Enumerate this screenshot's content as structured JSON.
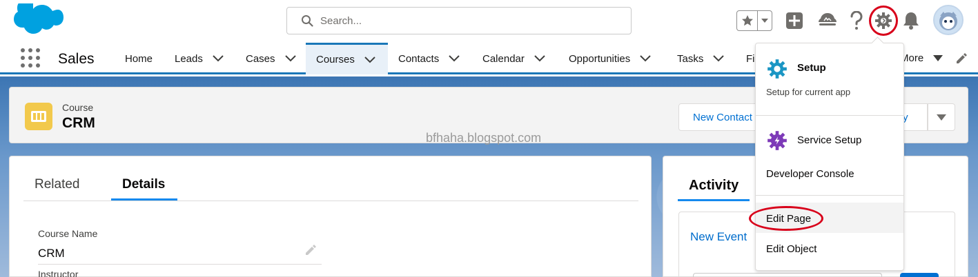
{
  "header": {
    "search_placeholder": "Search...",
    "icons": [
      "salesforce-logo",
      "search-icon",
      "star-icon",
      "chevron-down-icon",
      "plus-icon",
      "trailhead-icon",
      "help-icon",
      "gear-icon",
      "bell-icon",
      "avatar"
    ]
  },
  "nav": {
    "app_name": "Sales",
    "items": [
      {
        "label": "Home"
      },
      {
        "label": "Leads"
      },
      {
        "label": "Cases"
      },
      {
        "label": "Courses"
      },
      {
        "label": "Contacts"
      },
      {
        "label": "Calendar"
      },
      {
        "label": "Opportunities"
      },
      {
        "label": "Tasks"
      },
      {
        "label": "Fi"
      }
    ],
    "more_label": "More",
    "active_tab": "Courses"
  },
  "record": {
    "type_label": "Course",
    "name": "CRM",
    "button_new_contact": "New Contact",
    "button_partial": "ty"
  },
  "watermark": "bfhaha.blogspot.com",
  "details": {
    "tab_related": "Related",
    "tab_details": "Details",
    "field1_label": "Course Name",
    "field1_value": "CRM",
    "field2_label": "Instructor"
  },
  "activity": {
    "title": "Activity",
    "new_event": "New Event"
  },
  "dropdown": {
    "setup_title": "Setup",
    "setup_sub": "Setup for current app",
    "service_setup": "Service Setup",
    "developer_console": "Developer Console",
    "edit_page": "Edit Page",
    "edit_object": "Edit Object"
  },
  "colors": {
    "brand_blue": "#1a77b8",
    "link_blue": "#0070d2",
    "highlight_red": "#d8001a",
    "course_icon_yellow": "#f2c94c"
  }
}
